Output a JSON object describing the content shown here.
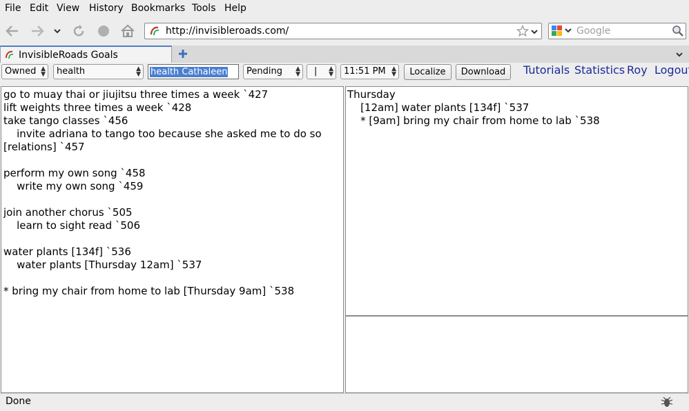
{
  "menubar": {
    "items": [
      {
        "label": "File"
      },
      {
        "label": "Edit"
      },
      {
        "label": "View"
      },
      {
        "label": "History"
      },
      {
        "label": "Bookmarks"
      },
      {
        "label": "Tools"
      },
      {
        "label": "Help"
      }
    ]
  },
  "navbar": {
    "url": "http://invisibleroads.com/",
    "search_placeholder": "Google",
    "icons": [
      "back-icon",
      "forward-icon",
      "history-dropdown-icon",
      "reload-icon",
      "stop-icon",
      "home-icon"
    ]
  },
  "tabs": [
    {
      "label": "InvisibleRoads Goals",
      "active": true
    }
  ],
  "toolbar": {
    "owner_select": "Owned",
    "category_select": "health",
    "filter_input": "health Cathaleen",
    "status_select": "Pending",
    "separator_select": "|",
    "time_select": "11:51 PM",
    "localize_label": "Localize",
    "download_label": "Download",
    "links": {
      "tutorials": "Tutorials",
      "statistics": "Statistics",
      "user": "Roy",
      "logout": "Logout"
    }
  },
  "goals_panel": {
    "lines": [
      "go to muay thai or jiujitsu three times a week `427",
      "lift weights three times a week `428",
      "take tango classes `456",
      "    invite adriana to tango too because she asked me to do so",
      "[relations] `457",
      "",
      "perform my own song `458",
      "    write my own song `459",
      "",
      "join another chorus `505",
      "    learn to sight read `506",
      "",
      "water plants [134f] `536",
      "    water plants [Thursday 12am] `537",
      "",
      "* bring my chair from home to lab [Thursday 9am] `538"
    ]
  },
  "schedule_panel": {
    "lines": [
      "Thursday",
      "    [12am] water plants [134f] `537",
      "    * [9am] bring my chair from home to lab `538"
    ]
  },
  "status": {
    "text": "Done"
  },
  "colors": {
    "link": "#1a2a9a",
    "selection": "#4a7fd0",
    "tab_accent": "#4f7fbf"
  }
}
